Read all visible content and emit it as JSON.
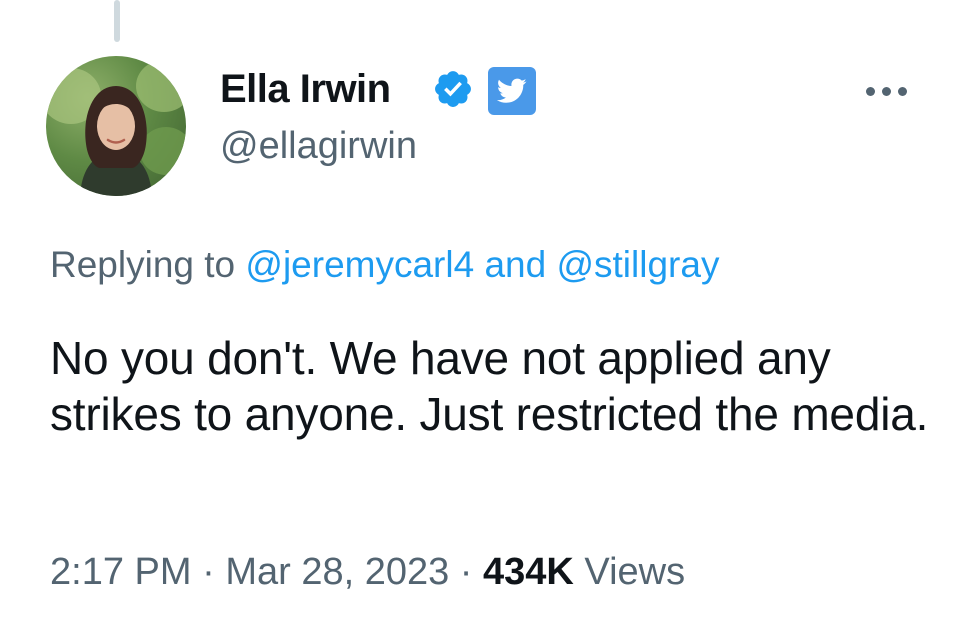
{
  "colors": {
    "accent": "#1d9bf0",
    "secondary_text": "#536471",
    "primary_text": "#0f1419",
    "verified": "#1d9bf0",
    "twitter_badge": "#4a99e9"
  },
  "author": {
    "name": "Ella Irwin",
    "handle": "@ellagirwin",
    "avatar_icon": "profile-photo",
    "verified_icon": "verified-badge-icon",
    "affiliate_icon": "twitter-bird-icon"
  },
  "menu": {
    "icon": "more-options-icon"
  },
  "reply": {
    "prefix": "Replying to",
    "mention_1": "@jeremycarl4",
    "conjunction": "and",
    "mention_2": "@stillgray"
  },
  "tweet": {
    "text": "No you don't. We have not applied any strikes to anyone. Just restricted the media."
  },
  "meta": {
    "time": "2:17 PM",
    "separator": "·",
    "date": "Mar 28, 2023",
    "views_count": "434K",
    "views_label": "Views"
  }
}
